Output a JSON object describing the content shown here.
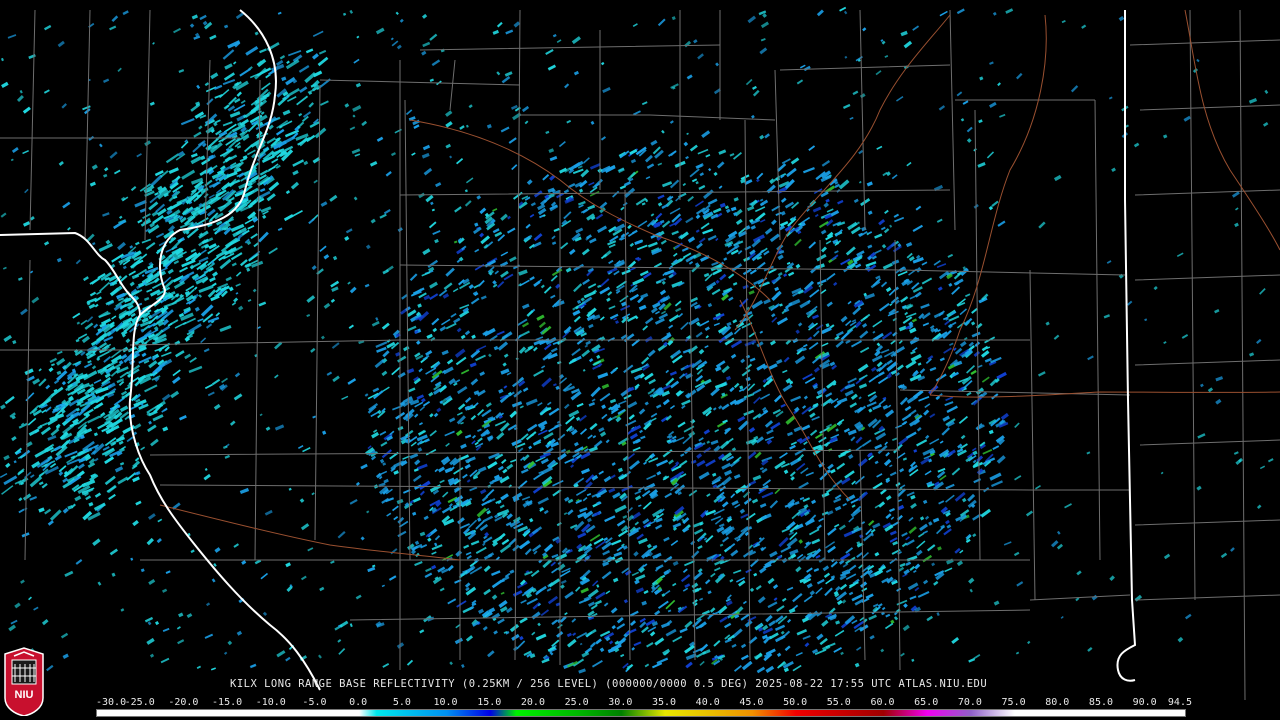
{
  "caption": "KILX LONG RANGE BASE REFLECTIVITY (0.25KM / 256 LEVEL) (000000/0000 0.5 DEG) 2025-08-22 17:55 UTC  ATLAS.NIU.EDU",
  "logo_text": "NIU",
  "colorbar": {
    "tick_labels": [
      "-30.0",
      "-25.0",
      "-20.0",
      "-15.0",
      "-10.0",
      "-5.0",
      "0.0",
      "5.0",
      "10.0",
      "15.0",
      "20.0",
      "25.0",
      "30.0",
      "35.0",
      "40.0",
      "45.0",
      "50.0",
      "55.0",
      "60.0",
      "65.0",
      "70.0",
      "75.0",
      "80.0",
      "85.0",
      "90.0",
      "94.5"
    ],
    "range": [
      -30.0,
      94.5
    ],
    "stops": [
      {
        "v": -30,
        "color": "#ffffff"
      },
      {
        "v": 0,
        "color": "#ffffff"
      },
      {
        "v": 2,
        "color": "#00e8ec"
      },
      {
        "v": 10,
        "color": "#0090f0"
      },
      {
        "v": 15,
        "color": "#0000e8"
      },
      {
        "v": 18,
        "color": "#00f000"
      },
      {
        "v": 25,
        "color": "#00b800"
      },
      {
        "v": 30,
        "color": "#008000"
      },
      {
        "v": 35,
        "color": "#e8e800"
      },
      {
        "v": 40,
        "color": "#e8c000"
      },
      {
        "v": 45,
        "color": "#f09000"
      },
      {
        "v": 50,
        "color": "#f00000"
      },
      {
        "v": 55,
        "color": "#c80000"
      },
      {
        "v": 60,
        "color": "#a00000"
      },
      {
        "v": 65,
        "color": "#f000f0"
      },
      {
        "v": 70,
        "color": "#9060c8"
      },
      {
        "v": 75,
        "color": "#ffffff"
      },
      {
        "v": 94.5,
        "color": "#ffffff"
      }
    ]
  },
  "colors": {
    "background": "#000000",
    "county_lines": "#6e6e6e",
    "state_lines": "#ffffff",
    "rivers": "#9a5030",
    "echo_light": "#20d8e0",
    "echo_mid": "#1aa0e8",
    "echo_dark": "#1040d0",
    "echo_green": "#30c030"
  }
}
